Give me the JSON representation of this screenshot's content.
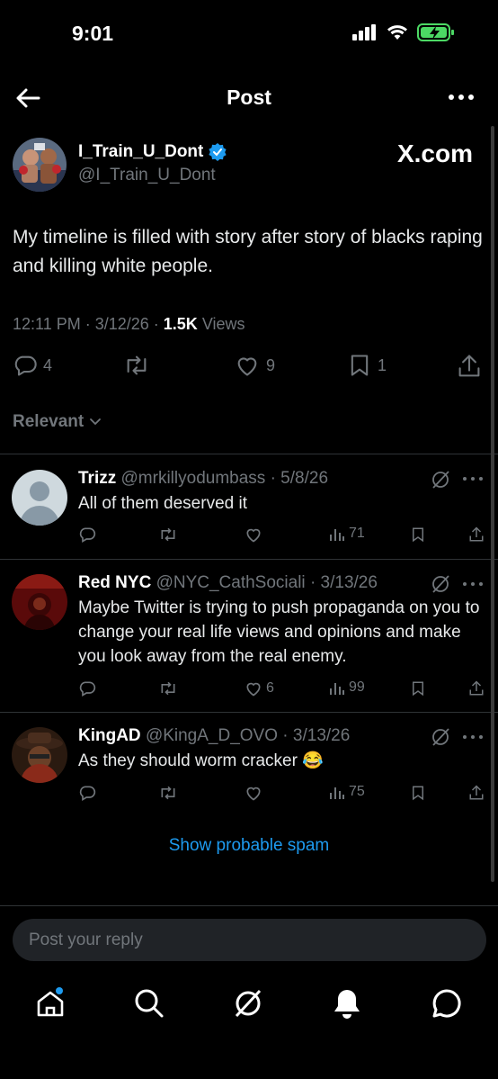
{
  "status_bar": {
    "time": "9:01"
  },
  "nav": {
    "title": "Post"
  },
  "post": {
    "author_name": "I_Train_U_Dont",
    "author_handle": "@I_Train_U_Dont",
    "watermark": "X.com",
    "text": "My timeline is filled with story after story of blacks raping and killing white people.",
    "time": "12:11 PM · 3/12/26 ·",
    "views_count": "1.5K",
    "views_label": "Views",
    "replies": "4",
    "likes": "9",
    "bookmarks": "1"
  },
  "sort": {
    "label": "Relevant"
  },
  "replies": [
    {
      "name": "Trizz",
      "handle": "@mrkillyodumbass",
      "date": "· 5/8/26",
      "text": "All of them deserved it",
      "likes": "",
      "views": "71"
    },
    {
      "name": "Red NYC",
      "handle": "@NYC_CathSociali",
      "date": "· 3/13/26",
      "text": "Maybe Twitter is trying to push propaganda on you to change your real life views and opinions and make you look away from the real enemy.",
      "likes": "6",
      "views": "99"
    },
    {
      "name": "KingAD",
      "handle": "@KingA_D_OVO",
      "date": "· 3/13/26",
      "text": "As they should worm cracker 😂",
      "likes": "",
      "views": "75"
    }
  ],
  "spam_link": "Show probable spam",
  "composer": {
    "placeholder": "Post your reply"
  },
  "colors": {
    "accent": "#1d9bf0",
    "background": "#000000",
    "muted": "#71767b"
  }
}
